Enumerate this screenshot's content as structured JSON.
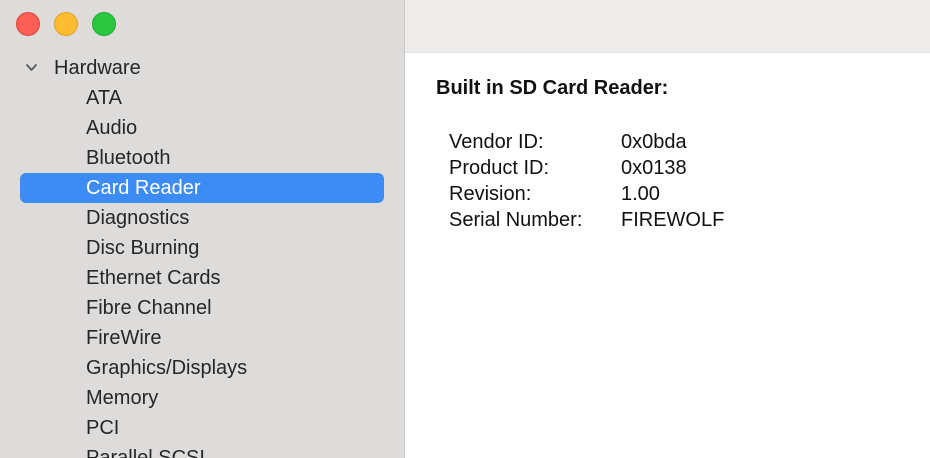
{
  "sidebar": {
    "group": {
      "label": "Hardware",
      "expanded": true
    },
    "items": [
      {
        "label": "ATA"
      },
      {
        "label": "Audio"
      },
      {
        "label": "Bluetooth"
      },
      {
        "label": "Card Reader",
        "selected": true
      },
      {
        "label": "Diagnostics"
      },
      {
        "label": "Disc Burning"
      },
      {
        "label": "Ethernet Cards"
      },
      {
        "label": "Fibre Channel"
      },
      {
        "label": "FireWire"
      },
      {
        "label": "Graphics/Displays"
      },
      {
        "label": "Memory"
      },
      {
        "label": "PCI"
      },
      {
        "label": "Parallel SCSI"
      }
    ]
  },
  "detail": {
    "title": "Built in SD Card Reader:",
    "properties": [
      {
        "key": "Vendor ID:",
        "value": "0x0bda"
      },
      {
        "key": "Product ID:",
        "value": "0x0138"
      },
      {
        "key": "Revision:",
        "value": "1.00"
      },
      {
        "key": "Serial Number:",
        "value": "FIREWOLF"
      }
    ]
  },
  "colors": {
    "selection": "#3d8cf6",
    "sidebar_bg": "#dedcdb",
    "close": "#fe5f57",
    "minimize": "#febc2e",
    "zoom": "#28c840"
  },
  "icons": {
    "disclosure": "chevron-down-icon"
  }
}
